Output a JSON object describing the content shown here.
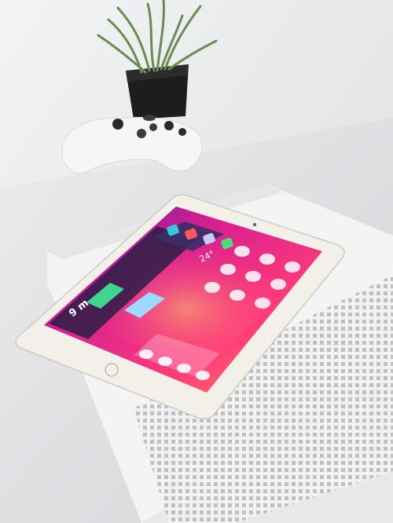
{
  "scene": {
    "subject": "tablet-on-game-console",
    "colors": {
      "wall": "#eceef0",
      "table": "#dfe0e2",
      "console": "#f1f1f1",
      "console_grille": "#c9cacb",
      "controller": "#f7f7f7",
      "plant_pot": "#1f1f1f",
      "plant_leaves": "#6f8f57",
      "tablet_bezel": "#f3f0ea",
      "screen_magenta": "#e0228c",
      "screen_orange": "#ff7a3a",
      "screen_purple": "#7a2bd8",
      "widget_bg": "#2b1f45"
    }
  },
  "tablet": {
    "widgets": {
      "weather_temp": "24°",
      "battery_big": "9 m",
      "button_left": "",
      "button_right": ""
    }
  }
}
